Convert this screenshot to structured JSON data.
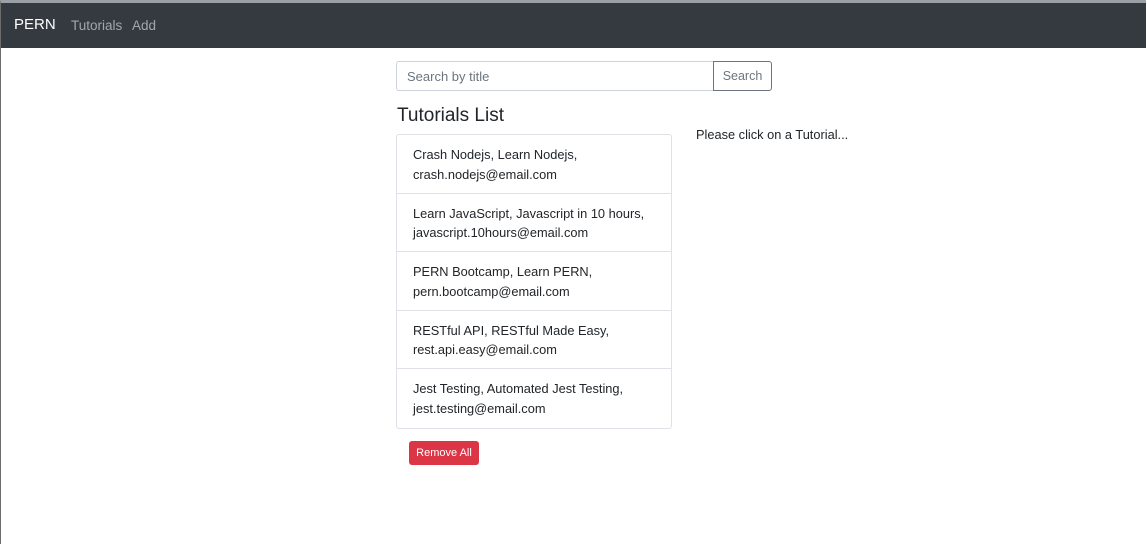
{
  "navbar": {
    "brand": "PERN",
    "links": [
      {
        "label": "Tutorials"
      },
      {
        "label": "Add"
      }
    ]
  },
  "search": {
    "placeholder": "Search by title",
    "value": "",
    "button_label": "Search"
  },
  "tutorials": {
    "title": "Tutorials List",
    "items": [
      {
        "line1": "Crash Nodejs, Learn Nodejs,",
        "line2": "crash.nodejs@email.com"
      },
      {
        "line1": "Learn JavaScript, Javascript in 10 hours,",
        "line2": "javascript.10hours@email.com"
      },
      {
        "line1": "PERN Bootcamp, Learn PERN,",
        "line2": "pern.bootcamp@email.com"
      },
      {
        "line1": "RESTful API, RESTful Made Easy,",
        "line2": "rest.api.easy@email.com"
      },
      {
        "line1": "Jest Testing, Automated Jest Testing,",
        "line2": "jest.testing@email.com"
      }
    ],
    "remove_all_label": "Remove All"
  },
  "detail": {
    "hint": "Please click on a Tutorial..."
  },
  "colors": {
    "navbar_bg": "#343a40",
    "danger": "#dc3545",
    "secondary": "#6c757d",
    "border": "#dee2e6"
  }
}
